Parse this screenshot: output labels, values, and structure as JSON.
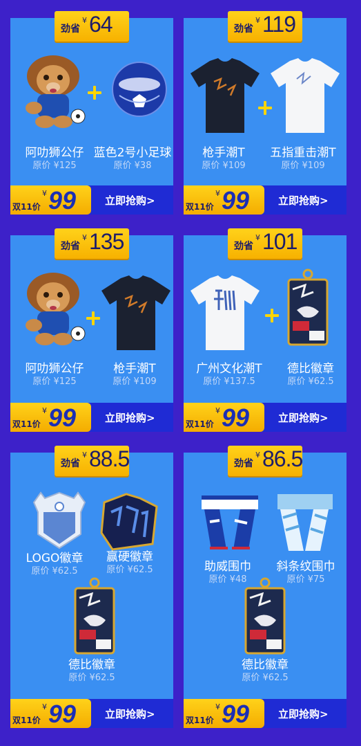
{
  "labels": {
    "save_prefix": "劲省",
    "currency": "¥",
    "price_label": "双11价",
    "buy_label": "立即抢购>",
    "orig_prefix": "原价"
  },
  "bundles": [
    {
      "saving": "64",
      "price": "99",
      "products": [
        {
          "name": "阿叻狮公仔",
          "orig": "原价 ¥125"
        },
        {
          "name": "蓝色2号小足球",
          "orig": "原价 ¥38"
        }
      ]
    },
    {
      "saving": "119",
      "price": "99",
      "products": [
        {
          "name": "枪手潮T",
          "orig": "原价 ¥109"
        },
        {
          "name": "五指重击潮T",
          "orig": "原价 ¥109"
        }
      ]
    },
    {
      "saving": "135",
      "price": "99",
      "products": [
        {
          "name": "阿叻狮公仔",
          "orig": "原价 ¥125"
        },
        {
          "name": "枪手潮T",
          "orig": "原价 ¥109"
        }
      ]
    },
    {
      "saving": "101",
      "price": "99",
      "products": [
        {
          "name": "广州文化潮T",
          "orig": "原价 ¥137.5"
        },
        {
          "name": "德比徽章",
          "orig": "原价 ¥62.5"
        }
      ]
    },
    {
      "saving": "88.5",
      "price": "99",
      "products": [
        {
          "name": "LOGO徽章",
          "orig": "原价 ¥62.5"
        },
        {
          "name": "赢硬徽章",
          "orig": "原价 ¥62.5"
        },
        {
          "name": "德比徽章",
          "orig": "原价 ¥62.5"
        }
      ]
    },
    {
      "saving": "86.5",
      "price": "99",
      "products": [
        {
          "name": "助威围巾",
          "orig": "原价 ¥48"
        },
        {
          "name": "斜条纹围巾",
          "orig": "原价 ¥75"
        },
        {
          "name": "德比徽章",
          "orig": "原价 ¥62.5"
        }
      ]
    }
  ],
  "images": {
    "lion_plush": "lion-plush-image",
    "soccer_ball": "blue-soccer-ball-image",
    "black_tee": "black-tshirt-image",
    "white_tee": "white-tshirt-image",
    "culture_tee": "culture-tshirt-image",
    "derby_badge": "derby-badge-image",
    "logo_badge": "logo-badge-image",
    "winner_badge": "winner-badge-image",
    "cheer_scarf": "cheer-scarf-image",
    "stripe_scarf": "stripe-scarf-image"
  },
  "colors": {
    "background": "#3d21c9",
    "card": "#3a8ff2",
    "gold": "#ffd21a",
    "buy_bar": "#1f2bd4",
    "price_text": "#1b2eb5"
  }
}
